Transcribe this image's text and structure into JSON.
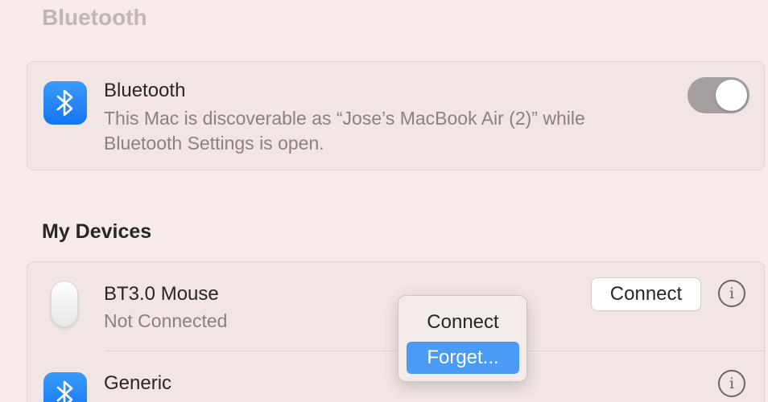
{
  "page": {
    "title": "Bluetooth"
  },
  "bluetooth_card": {
    "title": "Bluetooth",
    "description_line1": "This Mac is discoverable as “Jose’s MacBook Air (2)” while",
    "description_line2": "Bluetooth Settings is open.",
    "toggle_on": true,
    "icon": "bluetooth-icon"
  },
  "devices": {
    "heading": "My Devices",
    "items": [
      {
        "name": "BT3.0 Mouse",
        "status": "Not Connected",
        "action_label": "Connect",
        "icon": "mouse-icon"
      },
      {
        "name": "Generic",
        "icon": "bluetooth-icon"
      }
    ]
  },
  "context_menu": {
    "items": [
      {
        "label": "Connect",
        "selected": false
      },
      {
        "label": "Forget...",
        "selected": true
      }
    ]
  },
  "colors": {
    "background": "#f6ebe8",
    "accent_blue": "#1376f0",
    "menu_highlight": "#4a9bf6",
    "toggle_track": "#a5a09f"
  }
}
